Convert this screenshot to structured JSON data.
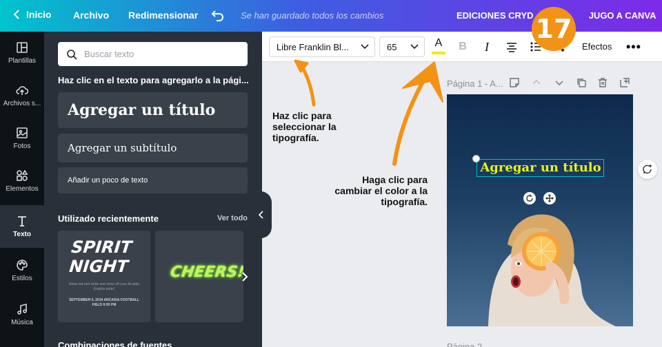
{
  "topbar": {
    "back_label": "Inicio",
    "archivo_label": "Archivo",
    "resize_label": "Redimensionar",
    "saved_status": "Se han guardado todos los cambios",
    "doc_title": "EDICIONES CRYD - S",
    "doc_title_tail": "JUGO A CANVA"
  },
  "badge": {
    "number": "17",
    "color": "#f39316"
  },
  "rail": {
    "items": [
      {
        "label": "Plantillas",
        "icon": "layout-icon"
      },
      {
        "label": "Archivos s...",
        "icon": "upload-cloud-icon"
      },
      {
        "label": "Fotos",
        "icon": "photo-icon"
      },
      {
        "label": "Elementos",
        "icon": "shapes-icon"
      },
      {
        "label": "Texto",
        "icon": "text-icon",
        "active": true
      },
      {
        "label": "Estilos",
        "icon": "palette-icon"
      },
      {
        "label": "Música",
        "icon": "music-icon"
      }
    ]
  },
  "panel": {
    "search_placeholder": "Buscar texto",
    "hint": "Haz clic en el texto para agregarlo a la pági...",
    "add_title": "Agregar un título",
    "add_subtitle": "Agregar un subtítulo",
    "add_body": "Añadir un poco de texto",
    "recent_title": "Utilizado recientemente",
    "recent_all": "Ver todo",
    "card1": {
      "line1": "SPIRIT",
      "line2": "NIGHT",
      "sub": "Wear red and white and show off your Arcadia Knights pride!",
      "date": "SEPTEMBER 5, 2034 ARCADIA FOOTBALL FIELD 6:00 PM"
    },
    "card2_text": "CHEERS!",
    "combos_title": "Combinaciones de fuentes"
  },
  "toolbar": {
    "font_name": "Libre Franklin Bl...",
    "font_size": "65",
    "color_letter": "A",
    "text_color": "#e6f019",
    "bold_letter": "B",
    "italic_letter": "I",
    "effects_label": "Efectos",
    "more_label": "•••"
  },
  "canvas": {
    "page_label": "Página 1 - A...",
    "title_text": "Agregar un título",
    "title_color": "#e8f21a",
    "page2_label": "Página 2"
  },
  "annotations": {
    "typography": "Haz clic para seleccionar la tipografía.",
    "color": "Haga clic para cambiar el color a la tipografía.",
    "arrow_color": "#f39316"
  }
}
